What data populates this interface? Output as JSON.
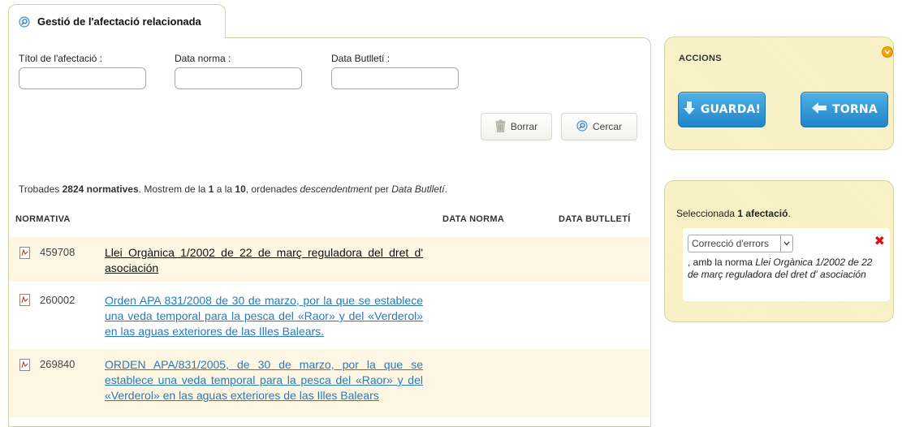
{
  "tab": {
    "title": "Gestió de l'afectació relacionada"
  },
  "filters": {
    "titol_label": "Títol de l'afectació :",
    "titol_value": "",
    "data_norma_label": "Data norma :",
    "data_norma_value": "",
    "data_butlleti_label": "Data Butlletí :",
    "data_butlleti_value": "",
    "borrar_label": "Borrar",
    "cercar_label": "Cercar"
  },
  "summary": {
    "prefix": "Trobades ",
    "count": "2824 normatives",
    "mid1": ". Mostrem de la ",
    "from": "1",
    "mid2": " a la ",
    "to": "10",
    "mid3": ", ordenades ",
    "order": "descendentment",
    "mid4": " per ",
    "field": "Data Butlletí",
    "suffix": "."
  },
  "table": {
    "headers": {
      "normativa": "NORMATIVA",
      "data_norma": "DATA NORMA",
      "data_butlleti": "DATA BUTLLETÍ"
    },
    "rows": [
      {
        "id": "459708",
        "title": "Llei Orgànica 1/2002 de 22 de març reguladora del dret d' asociación",
        "data_norma": "",
        "data_butlleti": ""
      },
      {
        "id": "260002",
        "title": "Orden APA 831/2008 de 30 de marzo, por la que se establece una veda temporal para la pesca del «Raor» y del «Verderol» en las aguas exteriores de las Illes Balears.",
        "data_norma": "",
        "data_butlleti": ""
      },
      {
        "id": "269840",
        "title": "ORDEN APA/831/2005, de 30 de marzo, por la que se establece una veda temporal para la pesca del «Raor» y del «Verderol» en las aguas exteriores de las Illes Balears",
        "data_norma": "",
        "data_butlleti": ""
      }
    ]
  },
  "accions": {
    "title": "ACCIONS",
    "guarda_label": "GUARDA!",
    "torna_label": "TORNA"
  },
  "selection": {
    "prefix": "Seleccionada ",
    "count": "1 afectació",
    "suffix": ".",
    "type_value": "Correcció d'errors",
    "desc_prefix": ", amb la norma ",
    "desc_norma": "Llei Orgànica 1/2002 de 22 de març reguladora del dret d' asociación"
  },
  "colors": {
    "accent_blue": "#2a7ab8",
    "button_blue": "#1f86c8",
    "side_bg": "#faf3c7",
    "row_alt_bg": "#fdf6e3",
    "remove_red": "#e01010",
    "collapse_orange": "#f2a400"
  },
  "icons": {
    "tab": "search-icon",
    "borrar": "trash-icon",
    "cercar": "search-icon",
    "rows": "document-icon",
    "collapse": "chevron-down-icon",
    "guarda": "arrow-down-icon",
    "torna": "arrow-left-icon",
    "remove": "close-icon"
  }
}
